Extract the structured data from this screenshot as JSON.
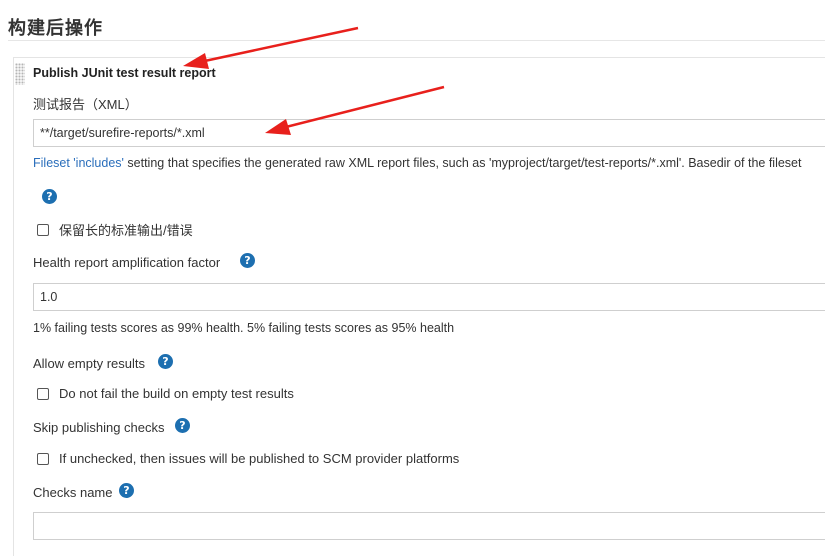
{
  "section": {
    "title": "构建后操作"
  },
  "step": {
    "title": "Publish JUnit test result report"
  },
  "test_report": {
    "label": "测试报告（XML）",
    "value": "**/target/surefire-reports/*.xml",
    "desc_link": "Fileset 'includes'",
    "desc_rest": " setting that specifies the generated raw XML report files, such as 'myproject/target/test-reports/*.xml'. Basedir of the fileset"
  },
  "keep_stdio": {
    "label": "保留长的标准输出/错误"
  },
  "health": {
    "label": "Health report amplification factor",
    "value": "1.0",
    "help_text": "1% failing tests scores as 99% health. 5% failing tests scores as 95% health"
  },
  "allow_empty": {
    "label": "Allow empty results",
    "checkbox_label": "Do not fail the build on empty test results"
  },
  "skip_checks": {
    "label": "Skip publishing checks",
    "checkbox_label": "If unchecked, then issues will be published to SCM provider platforms"
  },
  "checks_name": {
    "label": "Checks name",
    "value": ""
  },
  "icons": {
    "help": "help-icon",
    "drag": "drag-handle-icon"
  },
  "colors": {
    "link": "#2a6ebb",
    "help": "#1d6fb0",
    "arrow": "#e8201c"
  }
}
